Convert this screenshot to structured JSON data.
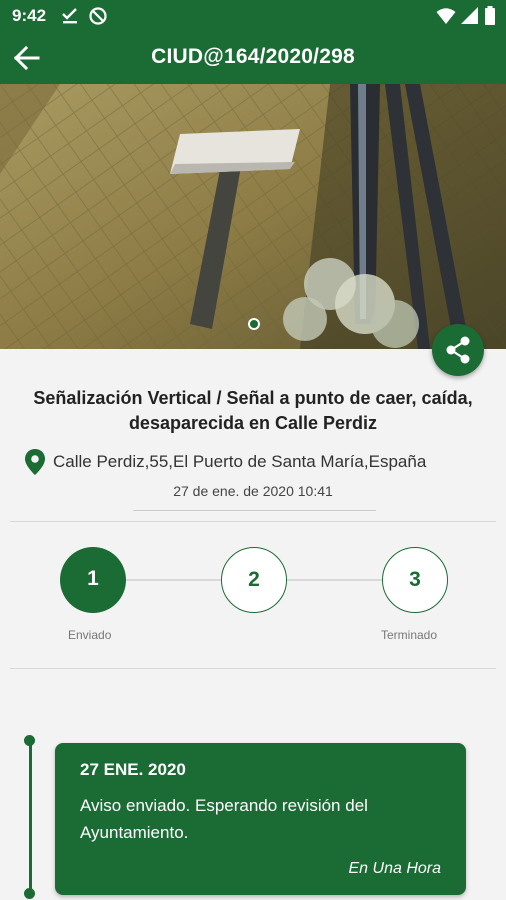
{
  "status_bar": {
    "time": "9:42"
  },
  "app_bar": {
    "title": "CIUD@164/2020/298"
  },
  "incident": {
    "title": "Señalización Vertical / Señal a punto de caer, caída, desaparecida en Calle Perdiz",
    "address": "Calle Perdiz,55,El Puerto de Santa María,España",
    "datetime": "27 de ene. de 2020 10:41"
  },
  "progress": {
    "steps": [
      {
        "number": "1",
        "label": "Enviado",
        "state": "done"
      },
      {
        "number": "2",
        "label": "",
        "state": "pending"
      },
      {
        "number": "3",
        "label": "Terminado",
        "state": "pending"
      }
    ]
  },
  "timeline": {
    "entries": [
      {
        "date": "27 ENE. 2020",
        "message": "Aviso enviado. Esperando revisión del Ayuntamiento.",
        "relative_time": "En Una Hora"
      }
    ]
  },
  "colors": {
    "primary": "#1b6b34",
    "background": "#f3f3f3"
  },
  "icons": {
    "back": "arrow-left-icon",
    "share": "share-icon",
    "location": "location-pin-icon"
  }
}
